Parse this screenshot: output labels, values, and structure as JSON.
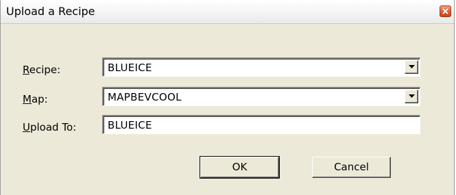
{
  "window": {
    "title": "Upload a Recipe"
  },
  "form": {
    "recipe": {
      "label_accel": "R",
      "label_rest": "ecipe:",
      "value": "BLUEICE"
    },
    "map": {
      "label_accel": "M",
      "label_rest": "ap:",
      "value": "MAPBEVCOOL"
    },
    "upload_to": {
      "label_accel": "U",
      "label_rest": "pload To:",
      "value": "BLUEICE"
    }
  },
  "buttons": {
    "ok": "OK",
    "cancel": "Cancel"
  },
  "icons": {
    "close": "close-icon",
    "dropdown": "chevron-down-icon"
  },
  "colors": {
    "dialog_bg": "#ece9d8",
    "close_button": "#e0603a"
  }
}
